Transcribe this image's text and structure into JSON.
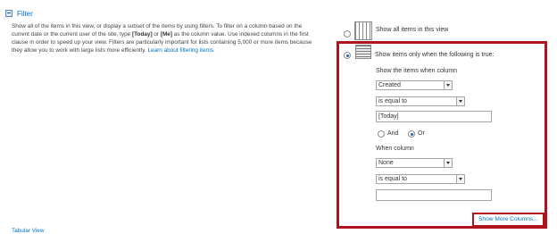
{
  "filter_section": {
    "title": "Filter",
    "description_parts": [
      "Show all of the items in this view, or display a subset of the items by using filters. To filter on a column based on the current date or the current user of the site, type ",
      "[Today]",
      " or ",
      "[Me]",
      " as the column value. Use indexed columns in the first clause in order to speed up your view. Filters are particularly important for lists containing 5,000 or more items because they allow you to work with large lists more efficiently. "
    ],
    "learn_more_link": "Learn about filtering items.",
    "footer_link": "Tabular View"
  },
  "options": {
    "show_all_label": "Show all items in this view",
    "show_when_label": "Show items only when the following is true:",
    "selected": "show_when"
  },
  "clause1": {
    "heading": "Show the items when column",
    "column": "Created",
    "operator": "is equal to",
    "value": "[Today]"
  },
  "connector": {
    "and_label": "And",
    "or_label": "Or",
    "selected": "Or"
  },
  "clause2": {
    "heading": "When column",
    "column": "None",
    "operator": "is equal to",
    "value": ""
  },
  "show_more_columns": "Show More Columns...",
  "colors": {
    "link": "#0072c6",
    "highlight_border": "#b0121e",
    "radio_dot": "#2d5da6"
  }
}
